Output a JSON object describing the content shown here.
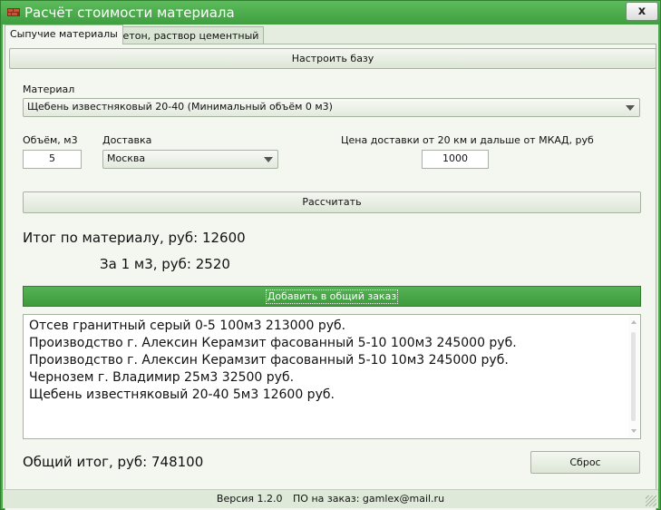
{
  "window": {
    "title": "Расчёт стоимости материала",
    "close_label": "x"
  },
  "tabs": [
    {
      "label": "Сыпучие материалы",
      "active": true
    },
    {
      "label": "Бетон, раствор цементный",
      "active": false
    }
  ],
  "form": {
    "configure_button": "Настроить базу",
    "material_label": "Материал",
    "material_value": "Щебень известняковый 20-40 (Минимальный объём 0 м3)",
    "volume_label": "Объём, м3",
    "volume_value": "5",
    "delivery_label": "Доставка",
    "delivery_value": "Москва",
    "delivery_price_label": "Цена доставки от 20 км и дальше от МКАД, руб",
    "delivery_price_value": "1000",
    "calculate_button": "Рассчитать",
    "total_material_text": "Итог по материалу, руб: 12600",
    "per_unit_text": "За 1 м3, руб: 2520",
    "add_button": "Добавить в общий заказ"
  },
  "order_list": [
    "Отсев гранитный серый 0-5 100м3 213000 руб.",
    "Производство г. Алексин Керамзит фасованный 5-10 100м3 245000 руб.",
    "Производство г. Алексин Керамзит фасованный 5-10 10м3 245000 руб.",
    "Чернозем г. Владимир 25м3 32500 руб.",
    "Щебень известняковый 20-40 5м3 12600 руб."
  ],
  "summary": {
    "grand_total_text": "Общий итог, руб: 748100",
    "reset_button": "Сброс"
  },
  "status_bar": {
    "version": "Версия 1.2.0",
    "contact": "ПО на заказ: gamlex@mail.ru"
  },
  "colors": {
    "accent": "#4aa84a",
    "background": "#f3f7f0"
  }
}
